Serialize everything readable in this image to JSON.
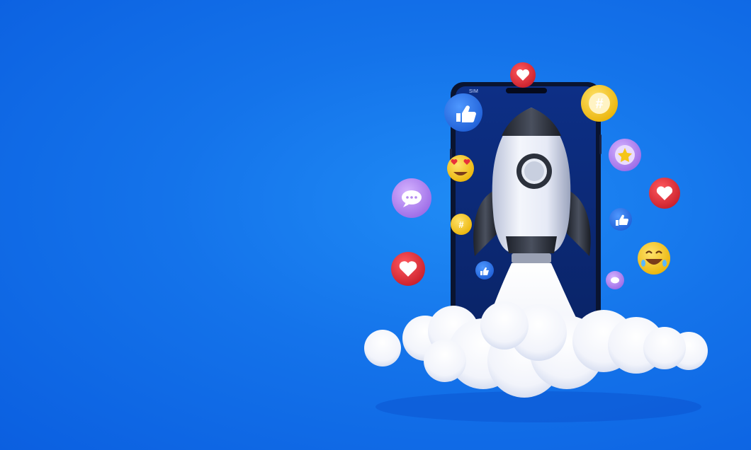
{
  "scene": {
    "background_color": "#1572EB",
    "phone": {
      "status_bar_label": "SIM",
      "screen_color": "#0b2a78",
      "frame_color": "#0a1430"
    },
    "rocket": {
      "body_color": "#e8ecf8",
      "fin_color": "#2a2f3a",
      "window_color": "#3a3f4a"
    },
    "cloud_color": "#ffffff",
    "icons": [
      {
        "name": "heart-icon",
        "color": "#e8303a"
      },
      {
        "name": "thumbs-up-icon",
        "color": "#2f7bf0"
      },
      {
        "name": "hashtag-icon",
        "color": "#f7c325"
      },
      {
        "name": "star-icon",
        "color": "#b58af0"
      },
      {
        "name": "heart-eyes-emoji",
        "color": "#f7c325"
      },
      {
        "name": "chat-bubble-icon",
        "color": "#b58af0"
      },
      {
        "name": "heart-icon",
        "color": "#e8303a"
      },
      {
        "name": "hashtag-icon",
        "color": "#f7c325"
      },
      {
        "name": "thumbs-up-icon",
        "color": "#2f7bf0"
      },
      {
        "name": "heart-icon",
        "color": "#e8303a"
      },
      {
        "name": "thumbs-up-icon",
        "color": "#2f7bf0"
      },
      {
        "name": "laughing-emoji",
        "color": "#f7c325"
      },
      {
        "name": "thumbs-up-icon",
        "color": "#2f7bf0"
      },
      {
        "name": "chat-bubble-icon",
        "color": "#b58af0"
      }
    ]
  }
}
